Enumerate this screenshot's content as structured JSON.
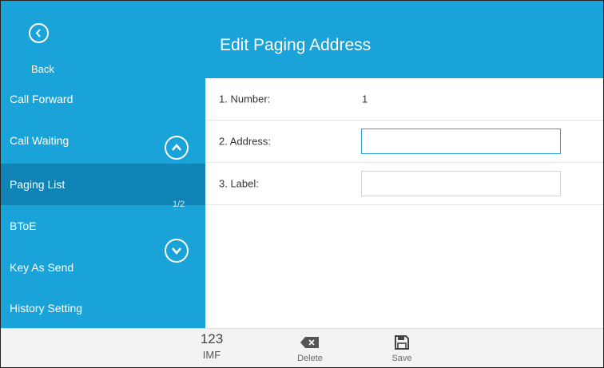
{
  "header": {
    "back_label": "Back",
    "title": "Edit Paging Address"
  },
  "sidebar": {
    "items": [
      {
        "label": "Call Forward",
        "active": false
      },
      {
        "label": "Call Waiting",
        "active": false
      },
      {
        "label": "Paging List",
        "active": true
      },
      {
        "label": "BToE",
        "active": false
      },
      {
        "label": "Key As Send",
        "active": false
      },
      {
        "label": "History Setting",
        "active": false
      }
    ],
    "page_indicator": "1/2"
  },
  "form": {
    "rows": [
      {
        "label": "1. Number:",
        "value": "1"
      },
      {
        "label": "2. Address:",
        "value": ""
      },
      {
        "label": "3. Label:",
        "value": ""
      }
    ]
  },
  "softkeys": {
    "imf_top": "123",
    "imf_bottom": "IMF",
    "delete_label": "Delete",
    "save_label": "Save"
  },
  "colors": {
    "primary": "#1aa3d9",
    "active_item": "#0f83b6",
    "focus_border": "#2aa2d5"
  },
  "icons": [
    "back-icon",
    "scroll-up-icon",
    "scroll-down-icon",
    "delete-icon",
    "save-icon"
  ]
}
